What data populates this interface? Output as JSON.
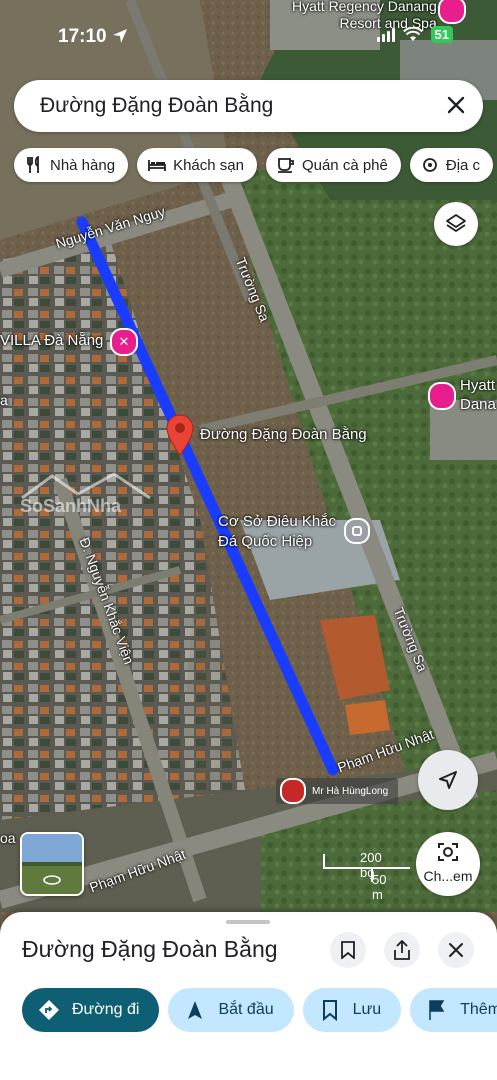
{
  "status_bar": {
    "time": "17:10",
    "battery": "51"
  },
  "search": {
    "query": "Đường Đặng Đoàn Bằng"
  },
  "chips": [
    {
      "label": "Nhà hàng",
      "icon": "fork-knife-icon"
    },
    {
      "label": "Khách sạn",
      "icon": "bed-icon"
    },
    {
      "label": "Quán cà phê",
      "icon": "coffee-cup-icon"
    },
    {
      "label": "Địa c",
      "icon": "attraction-icon"
    }
  ],
  "map": {
    "places": {
      "resort": "Hyatt Regency Danang\nResort and Spa",
      "resort_line1": "Hyatt Regency Danang",
      "resort_line2": "Resort and Spa",
      "villa": "VILLA Đà Nẵng",
      "hyatt_right1": "Hyatt",
      "hyatt_right2": "Dana",
      "pin_label": "Đường Đặng Đoàn Bằng",
      "poi_line1": "Cơ Sở Điêu Khắc",
      "poi_line2": "Đá Quốc Hiệp"
    },
    "roads": {
      "nguyen_van_nguyen": "Nguyễn Văn Nguy",
      "truong_sa_top": "Trường Sa",
      "truong_sa_bottom": "Trường Sa",
      "nguyen_khac_vien": "Đ. Nguyễn Khắc Viện",
      "pham_huu_nhat_right": "Phạm Hữu Nhật",
      "pham_huu_nhat_bottom": "Phạm Hữu Nhật",
      "oa": "oa",
      "left_a": "a"
    },
    "watermark": "SoSanhNha",
    "watermark_sub": "Mr Hà HùngLong",
    "scale": {
      "ft": "200 bộ",
      "m": "50 m"
    }
  },
  "lens": {
    "label": "Ch...em"
  },
  "sheet": {
    "title": "Đường Đặng Đoàn Bằng",
    "actions": [
      {
        "label": "Đường đi",
        "icon": "directions-icon"
      },
      {
        "label": "Bắt đầu",
        "icon": "navigation-arrow-icon"
      },
      {
        "label": "Lưu",
        "icon": "bookmark-icon"
      },
      {
        "label": "Thêm",
        "icon": "flag-icon"
      }
    ]
  },
  "colors": {
    "route": "#1a3cff",
    "pin": "#ea4335",
    "primary": "#0e5f73",
    "chip_bg": "#c2e7ff"
  }
}
